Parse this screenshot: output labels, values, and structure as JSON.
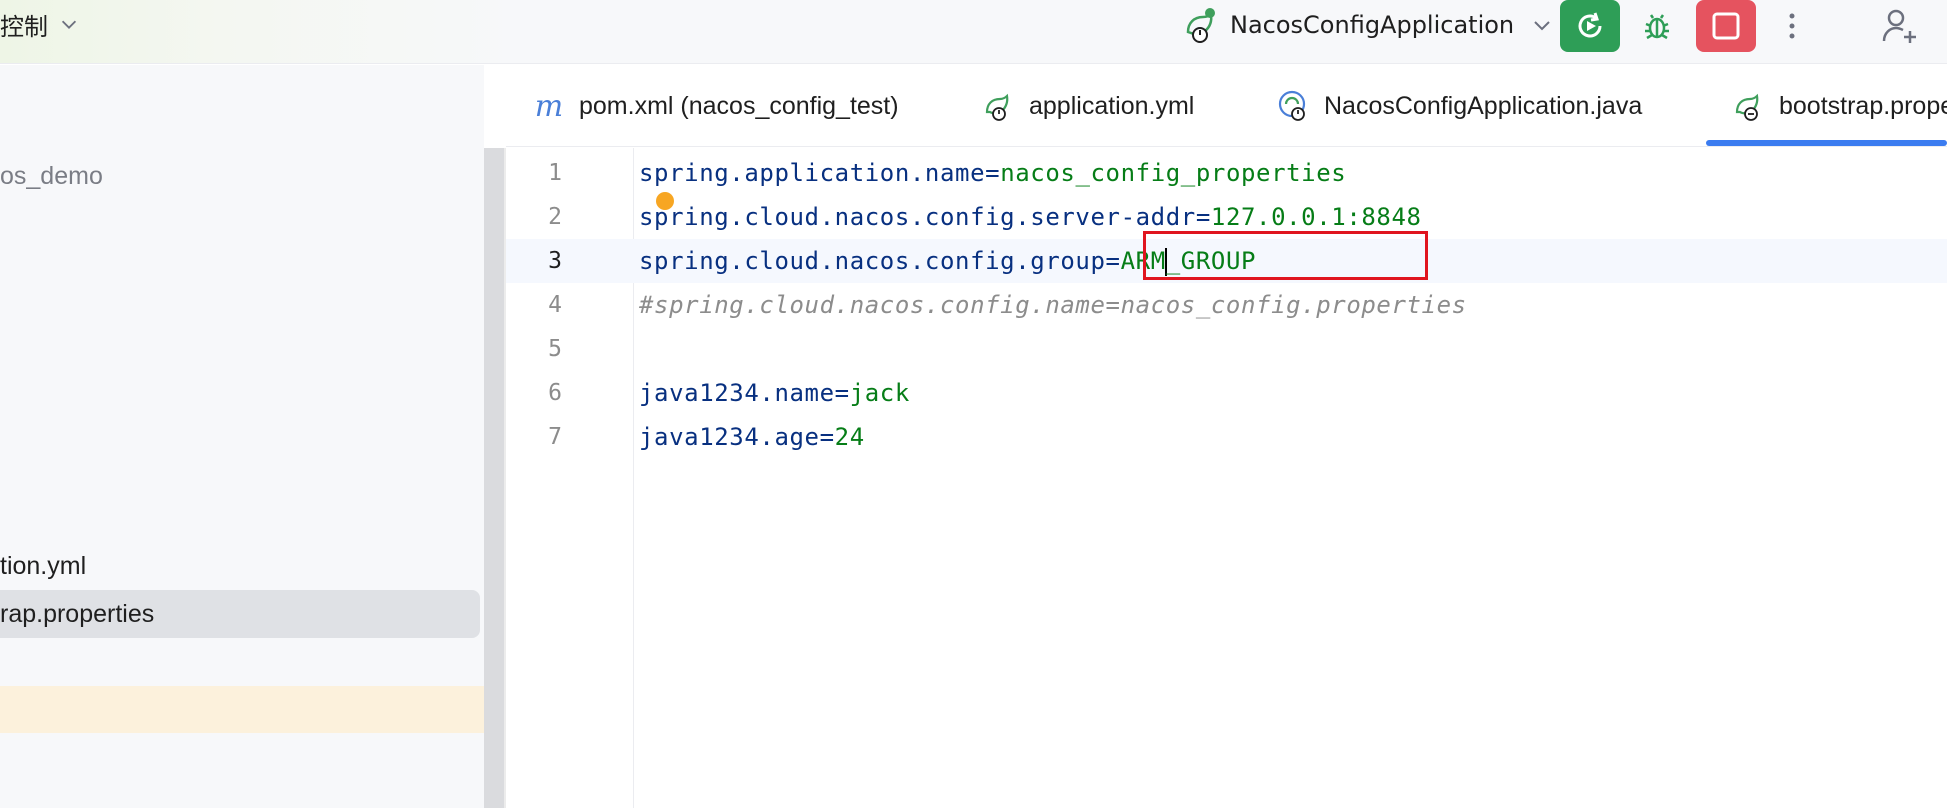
{
  "topbar": {
    "vcs_label": "控制",
    "run_config_name": "NacosConfigApplication",
    "colors": {
      "run": "#2e9e57",
      "stop": "#e5535f"
    }
  },
  "project": {
    "root_label": "os_demo",
    "items": [
      {
        "label": "tion.yml"
      },
      {
        "label": "rap.properties",
        "selected": true
      }
    ]
  },
  "tabs": [
    {
      "label": "pom.xml (nacos_config_test)",
      "icon": "maven-m-icon"
    },
    {
      "label": "application.yml",
      "icon": "spring-config-icon"
    },
    {
      "label": "NacosConfigApplication.java",
      "icon": "spring-boot-app-icon"
    },
    {
      "label": "bootstrap.prope",
      "icon": "spring-config-icon",
      "active": true
    }
  ],
  "editor": {
    "lines": [
      {
        "num": "1",
        "key": "spring.application.name",
        "eq": "=",
        "value": "nacos_config_properties"
      },
      {
        "num": "2",
        "key": "spring.cloud.nacos.config.server-addr",
        "eq": "=",
        "value": "127.0.0.1:8848"
      },
      {
        "num": "3",
        "key": "spring.cloud.nacos.config.group",
        "eq": "=",
        "value_a": "ARM",
        "value_b": "_GROUP",
        "current": true
      },
      {
        "num": "4",
        "comment": "#spring.cloud.nacos.config.name=nacos_config.properties"
      },
      {
        "num": "5"
      },
      {
        "num": "6",
        "key": "java1234.name",
        "eq": "=",
        "value": "jack"
      },
      {
        "num": "7",
        "key": "java1234.age",
        "eq": "=",
        "value": "24"
      }
    ]
  }
}
